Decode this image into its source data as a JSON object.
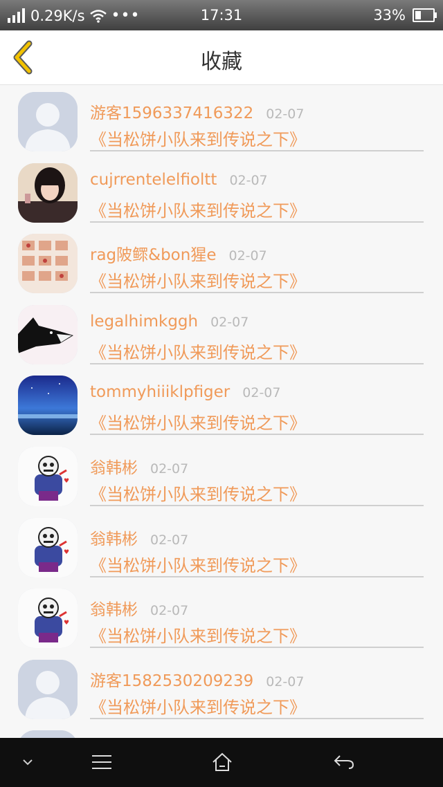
{
  "status": {
    "speed": "0.29K/s",
    "time": "17:31",
    "battery": "33%",
    "battery_level": 0.33
  },
  "header": {
    "title": "收藏"
  },
  "items": [
    {
      "name": "游客1596337416322",
      "date": "02-07",
      "topic": "《当松饼小队来到传说之下》",
      "avatar": "default"
    },
    {
      "name": "cujrrentelelfioltt",
      "date": "02-07",
      "topic": "《当松饼小队来到传说之下》",
      "avatar": "girl"
    },
    {
      "name": "rag陂鳏&bon猩e",
      "date": "02-07",
      "topic": "《当松饼小队来到传说之下》",
      "avatar": "stamps"
    },
    {
      "name": "legalhimkggh",
      "date": "02-07",
      "topic": "《当松饼小队来到传说之下》",
      "avatar": "cat"
    },
    {
      "name": "tommyhiiiklpfiger",
      "date": "02-07",
      "topic": "《当松饼小队来到传说之下》",
      "avatar": "sky"
    },
    {
      "name": "翁韩彬",
      "date": "02-07",
      "topic": "《当松饼小队来到传说之下》",
      "avatar": "skeleton"
    },
    {
      "name": "翁韩彬",
      "date": "02-07",
      "topic": "《当松饼小队来到传说之下》",
      "avatar": "skeleton"
    },
    {
      "name": "翁韩彬",
      "date": "02-07",
      "topic": "《当松饼小队来到传说之下》",
      "avatar": "skeleton"
    },
    {
      "name": "游客1582530209239",
      "date": "02-07",
      "topic": "《当松饼小队来到传说之下》",
      "avatar": "default"
    },
    {
      "name": "",
      "date": "",
      "topic": "",
      "avatar": "default"
    }
  ],
  "icons": {
    "back": "chevron-left-icon",
    "nav": [
      "chevron-down-icon",
      "menu-icon",
      "home-icon",
      "return-icon"
    ]
  },
  "colors": {
    "accent": "#f09a59",
    "back_arrow": "#f2c200",
    "date": "#b9b9b9"
  }
}
